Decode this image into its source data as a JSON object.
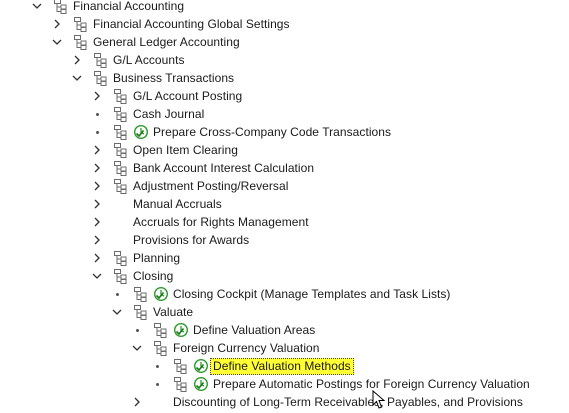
{
  "tree": {
    "items": [
      {
        "label": "Financial Accounting",
        "level": 0,
        "state": "expanded",
        "activity": false
      },
      {
        "label": "Financial Accounting Global Settings",
        "level": 1,
        "state": "collapsed",
        "activity": false
      },
      {
        "label": "General Ledger Accounting",
        "level": 1,
        "state": "expanded",
        "activity": false
      },
      {
        "label": "G/L Accounts",
        "level": 2,
        "state": "collapsed",
        "activity": false
      },
      {
        "label": "Business Transactions",
        "level": 2,
        "state": "expanded",
        "activity": false
      },
      {
        "label": "G/L Account Posting",
        "level": 3,
        "state": "collapsed",
        "activity": false
      },
      {
        "label": "Cash Journal",
        "level": 3,
        "state": "leaf",
        "activity": false
      },
      {
        "label": "Prepare Cross-Company Code Transactions",
        "level": 3,
        "state": "leaf",
        "activity": true
      },
      {
        "label": "Open Item Clearing",
        "level": 3,
        "state": "collapsed",
        "activity": false
      },
      {
        "label": "Bank Account Interest Calculation",
        "level": 3,
        "state": "collapsed",
        "activity": false
      },
      {
        "label": "Adjustment Posting/Reversal",
        "level": 3,
        "state": "collapsed",
        "activity": false
      },
      {
        "label": "Manual Accruals",
        "level": 3,
        "state": "collapsed",
        "activity": false,
        "noicon": true
      },
      {
        "label": "Accruals for Rights Management",
        "level": 3,
        "state": "collapsed",
        "activity": false,
        "noicon": true
      },
      {
        "label": "Provisions for Awards",
        "level": 3,
        "state": "collapsed",
        "activity": false,
        "noicon": true
      },
      {
        "label": "Planning",
        "level": 3,
        "state": "collapsed",
        "activity": false
      },
      {
        "label": "Closing",
        "level": 3,
        "state": "expanded",
        "activity": false
      },
      {
        "label": "Closing Cockpit (Manage Templates and Task Lists)",
        "level": 4,
        "state": "leaf",
        "activity": true
      },
      {
        "label": "Valuate",
        "level": 4,
        "state": "expanded",
        "activity": false
      },
      {
        "label": "Define Valuation Areas",
        "level": 5,
        "state": "leaf",
        "activity": true
      },
      {
        "label": "Foreign Currency Valuation",
        "level": 5,
        "state": "expanded",
        "activity": false
      },
      {
        "label": "Define Valuation Methods",
        "level": 6,
        "state": "leaf",
        "activity": true,
        "selected": true
      },
      {
        "label": "Prepare Automatic Postings for Foreign Currency Valuation",
        "level": 6,
        "state": "leaf",
        "activity": true
      },
      {
        "label": "Discounting of Long-Term Receivables, Payables, and Provisions",
        "level": 5,
        "state": "collapsed",
        "activity": false,
        "noicon": true
      }
    ]
  },
  "colors": {
    "highlight": "#ffff33",
    "activity_green": "#2a9a2a",
    "icon_gray": "#6b6b6b"
  }
}
